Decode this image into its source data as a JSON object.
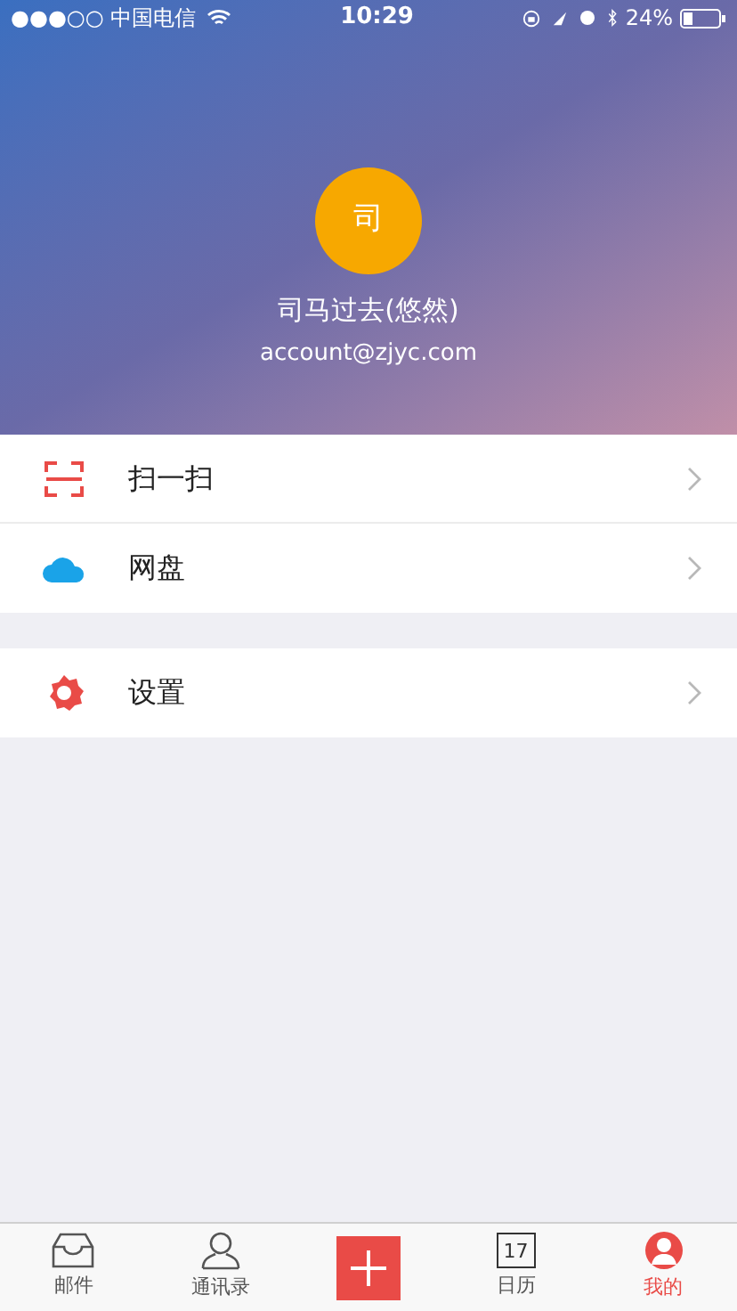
{
  "status_bar": {
    "carrier": "●●●○○ 中国电信",
    "time": "10:29",
    "battery": "24%"
  },
  "profile": {
    "avatar_text": "司",
    "name": "司马过去(悠然)",
    "email": "account@zjyc.com"
  },
  "menu_groups": [
    {
      "items": [
        {
          "kind": "scan",
          "label": "扫一扫"
        },
        {
          "kind": "cloud",
          "label": "网盘"
        }
      ]
    },
    {
      "items": [
        {
          "kind": "gear",
          "label": "设置"
        }
      ]
    }
  ],
  "tabs": [
    {
      "kind": "mail",
      "label": "邮件",
      "selected": false
    },
    {
      "kind": "contacts",
      "label": "通讯录",
      "selected": false
    },
    {
      "kind": "add",
      "selected": false
    },
    {
      "kind": "calendar",
      "label": "日历",
      "date": "17",
      "selected": false
    },
    {
      "kind": "profile",
      "label": "我的",
      "selected": true
    }
  ]
}
